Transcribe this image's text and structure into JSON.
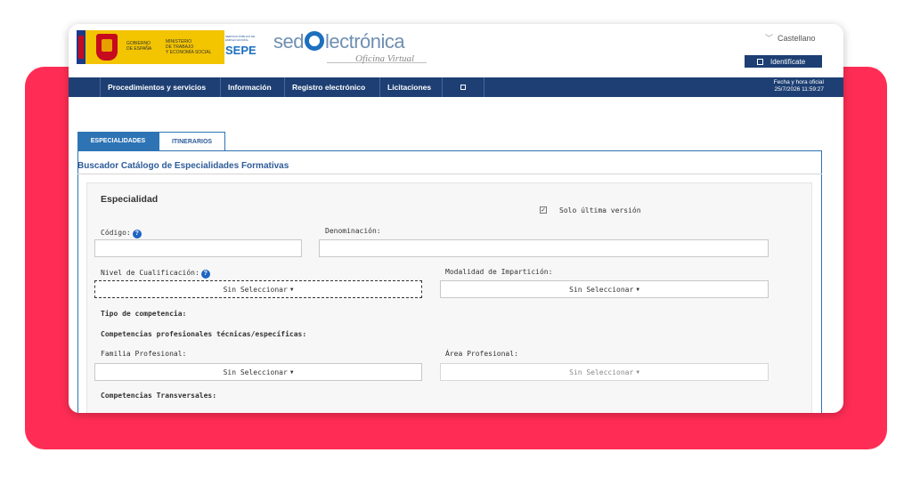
{
  "header": {
    "gobierno": "GOBIERNO\nDE ESPAÑA",
    "ministerio": "MINISTERIO\nDE TRABAJO\nY ECONOMÍA SOCIAL",
    "sepe_small": "SERVICIO PÚBLICO DE EMPLEO ESTATAL",
    "sepe": "SEPE",
    "sede_prefix": "sed",
    "sede_suffix": "lectrónica",
    "oficina": "Oficina Virtual",
    "language": "Castellano",
    "identificate": "Identifícate"
  },
  "nav": {
    "items": [
      "Procedimientos y servicios",
      "Información",
      "Registro electrónico",
      "Licitaciones"
    ],
    "date_label": "Fecha y hora oficial",
    "date_value": "25/7/2026 11:59:27"
  },
  "tabs": [
    "ESPECIALIDADES",
    "ITINERARIOS"
  ],
  "panel_title": "Buscador Catálogo de Especialidades Formativas",
  "form": {
    "section_title": "Especialidad",
    "solo_ultima": "Solo última versión",
    "codigo_label": "Código:",
    "denominacion_label": "Denominación:",
    "nivel_label": "Nivel de Cualificación:",
    "modalidad_label": "Modalidad de Impartición:",
    "tipo_label": "Tipo de competencia:",
    "comp_prof_label": "Competencias profesionales técnicas/específicas:",
    "familia_label": "Familia Profesional:",
    "area_label": "Área Profesional:",
    "comp_trans_label": "Competencias Transversales:",
    "select_placeholder": "Sin Seleccionar",
    "help_glyph": "?",
    "check_glyph": "✓"
  }
}
